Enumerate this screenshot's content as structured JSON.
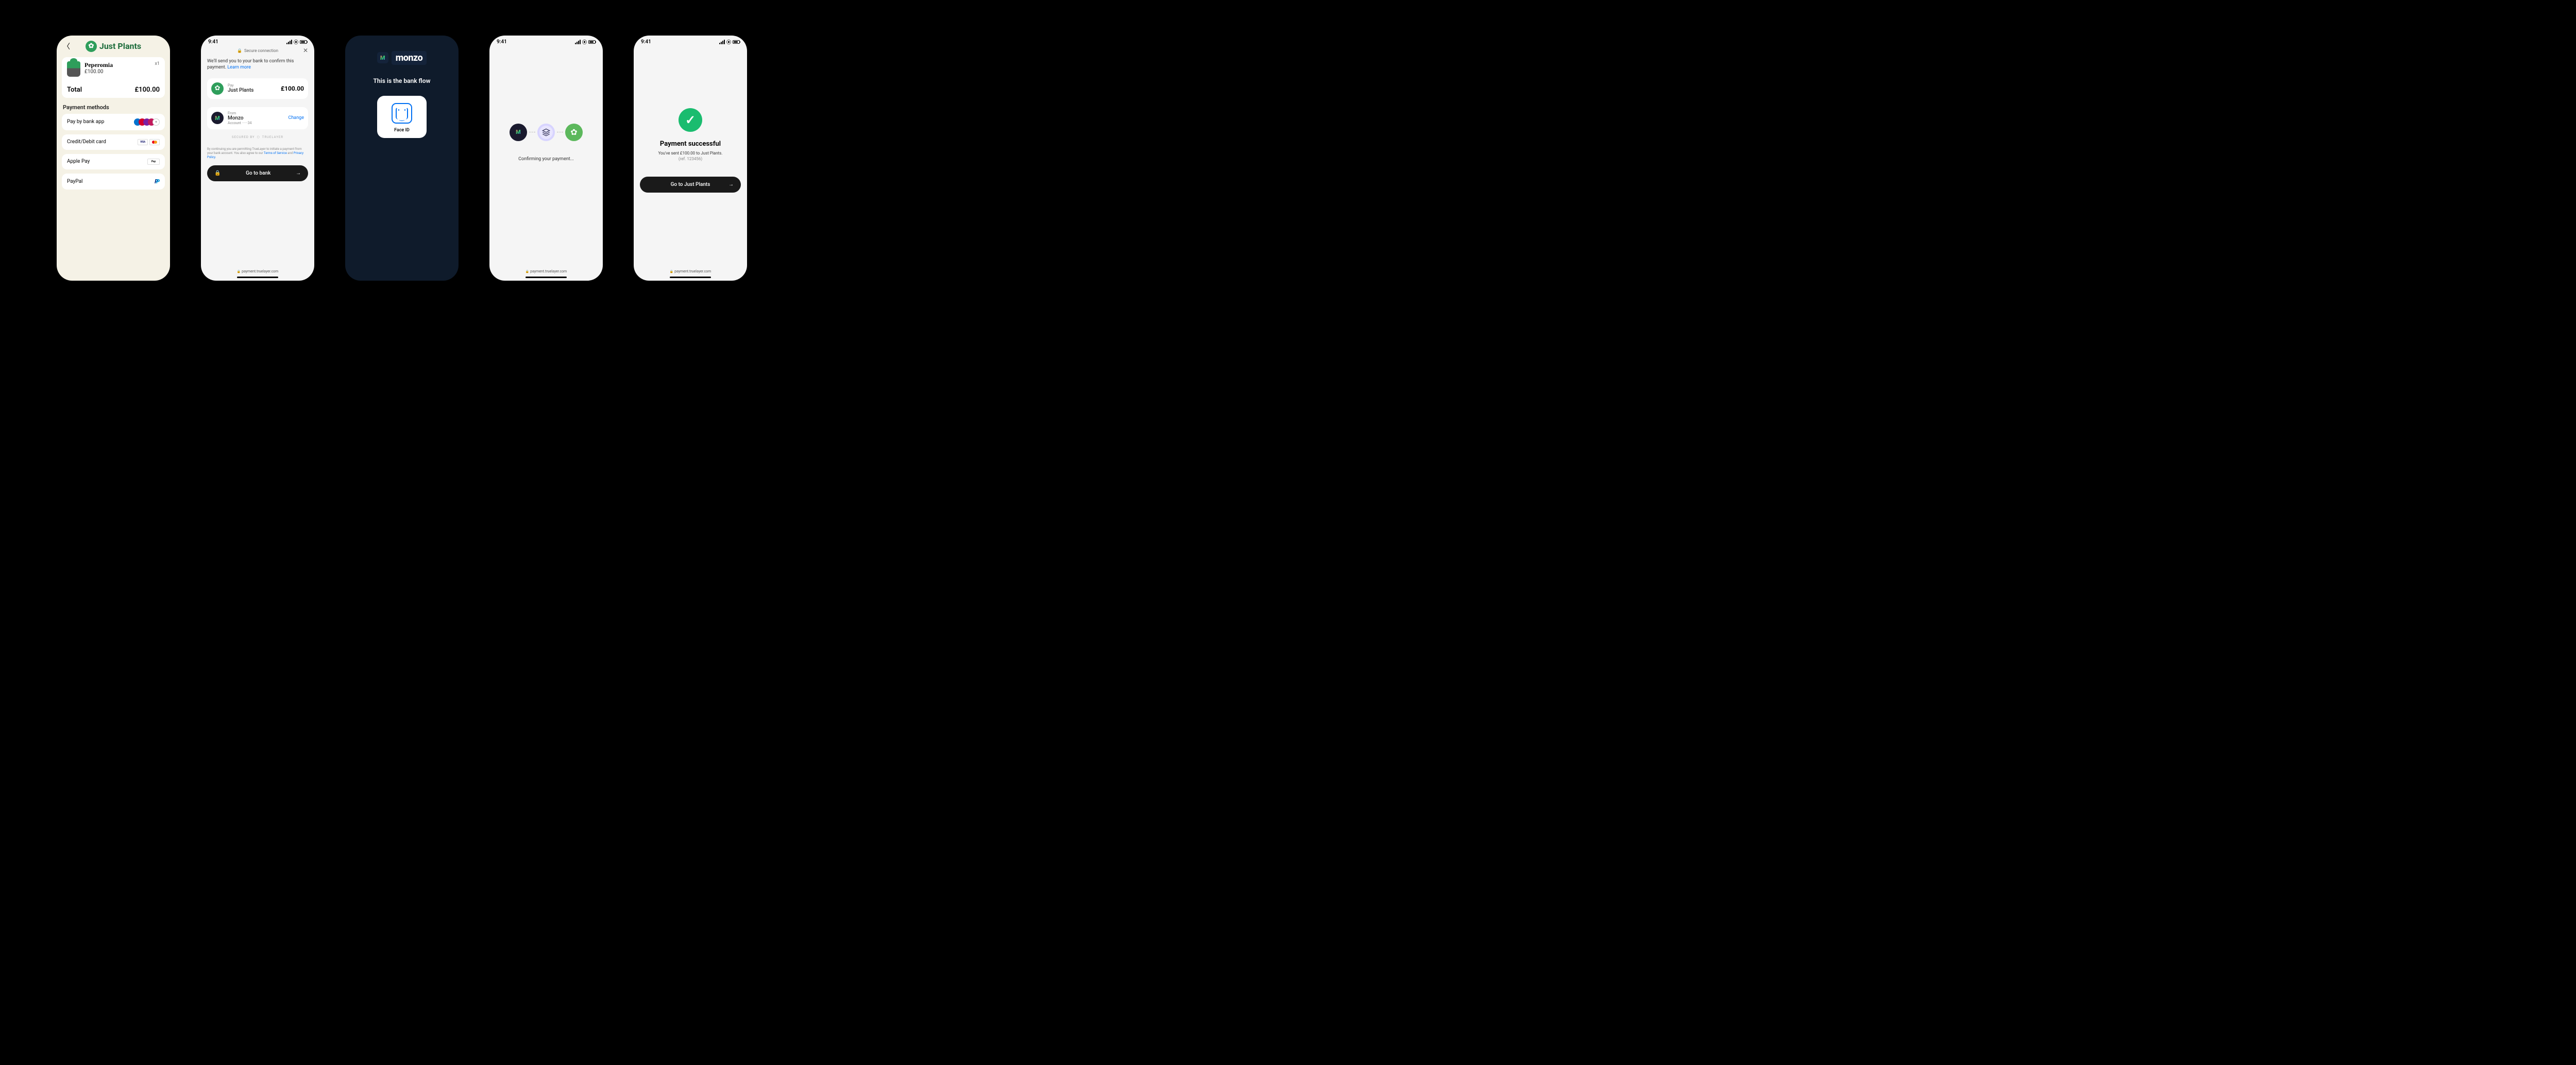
{
  "status_time": "9:41",
  "screen1": {
    "brand": "Just Plants",
    "product_name": "Peperomia",
    "product_price": "£100.00",
    "qty": "x1",
    "total_label": "Total",
    "total_amount": "£100.00",
    "methods_title": "Payment methods",
    "m1": "Pay by bank app",
    "m2": "Credit/Debit card",
    "m3": "Apple Pay",
    "m4": "PayPal",
    "visa": "VISA",
    "applepay": " Pay",
    "plus": "+"
  },
  "screen2": {
    "secure": "Secure connection",
    "intro": "We'll send you to your bank to confirm this payment. ",
    "learn": "Learn more",
    "pay_label": "Pay",
    "pay_to": "Just Plants",
    "amount": "£100.00",
    "from_label": "From",
    "from_bank": "Monzo",
    "account": "Account ······34",
    "change": "Change",
    "secured_by": "SECURED BY",
    "truelayer": "TRUELAYER",
    "legal1": "By continuing you are permitting TrueLayer to initiate a payment from your bank account. You also agree to our ",
    "terms": "Terms of Service",
    "and": " and ",
    "privacy": "Privacy Policy",
    "dot": ".",
    "btn": "Go to bank",
    "url": "payment.truelayer.com"
  },
  "screen3": {
    "brand": "monzo",
    "msg": "This is the bank flow",
    "faceid": "Face ID"
  },
  "screen4": {
    "msg": "Confirming your payment...",
    "url": "payment.truelayer.com"
  },
  "screen5": {
    "title": "Payment successful",
    "sub": "You've sent £100.00 to Just Plants.",
    "ref": "(ref. 123456)",
    "btn": "Go to Just Plants",
    "url": "payment.truelayer.com"
  }
}
